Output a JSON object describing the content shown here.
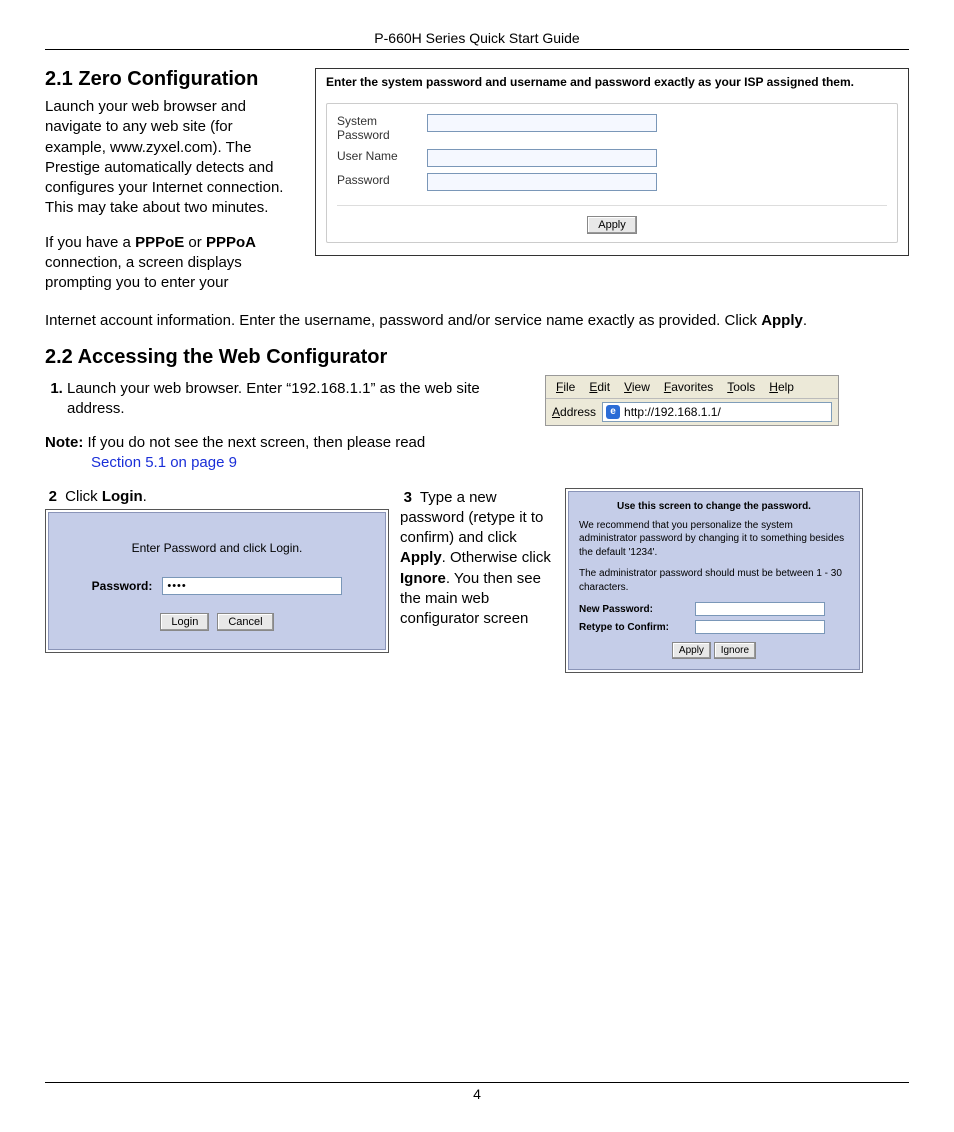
{
  "header": "P-660H Series Quick Start Guide",
  "page_number": "4",
  "section21": {
    "heading": "2.1 Zero Configuration",
    "para1": "Launch your web browser and navigate to any web site (for example, www.zyxel.com). The Prestige automatically detects and configures your Internet connection. This may take about two minutes.",
    "para2a": "If you have a ",
    "pppoe": "PPPoE",
    "or": " or ",
    "pppoa": "PPPoA",
    "para2b": " connection, a screen displays prompting you to enter your",
    "para3a": "Internet account information. Enter the username, password and/or service name exactly as provided. Click ",
    "apply_bold": "Apply",
    "period": "."
  },
  "isp_box": {
    "instruction": "Enter the system password and username and password exactly as your ISP assigned them.",
    "system_password_label": "System Password",
    "username_label": "User Name",
    "password_label": "Password",
    "apply_btn": "Apply"
  },
  "section22": {
    "heading": "2.2 Accessing the Web Configurator",
    "step1": "Launch your web browser. Enter “192.168.1.1” as the web site address.",
    "note_label": "Note:",
    "note_text": " If you do not see the next screen, then please read ",
    "note_link": "Section 5.1 on page 9",
    "step2_num": "2",
    "step2_a": " Click ",
    "step2_b": "Login",
    "step2_c": ".",
    "step3_num": "3",
    "step3_a": " Type a new password (retype it to confirm) and click ",
    "step3_apply": "Apply",
    "step3_b": ". Otherwise click ",
    "step3_ignore": "Ignore",
    "step3_c": ". You then see the main web configurator screen"
  },
  "browser": {
    "menu": {
      "file": "File",
      "edit": "Edit",
      "view": "View",
      "favorites": "Favorites",
      "tools": "Tools",
      "help": "Help"
    },
    "address_label_pre": "A",
    "address_label_post": "ddress",
    "address_value": "http://192.168.1.1/",
    "ie_glyph": "e"
  },
  "login_box": {
    "title": "Enter Password and click Login.",
    "password_label": "Password:",
    "password_value": "••••",
    "login_btn": "Login",
    "cancel_btn": "Cancel"
  },
  "chpw_box": {
    "title": "Use this screen to change the password.",
    "line1": "We recommend that you personalize the system administrator password by changing it to something besides the default '1234'.",
    "line2": "The administrator password should must be between 1 - 30 characters.",
    "new_password_label": "New Password:",
    "retype_label": "Retype to Confirm:",
    "apply_btn": "Apply",
    "ignore_btn": "Ignore"
  }
}
